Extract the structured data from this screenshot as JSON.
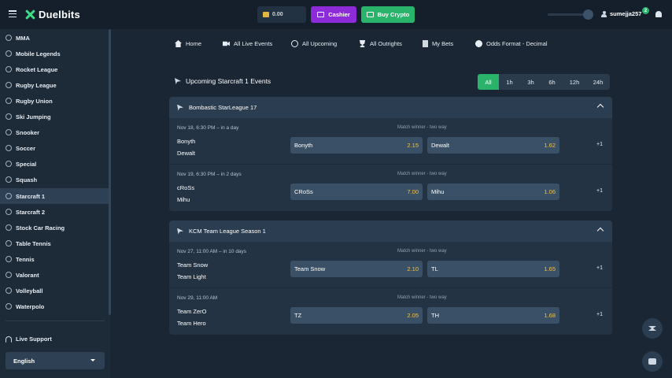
{
  "topbar": {
    "brand": "Duelbits",
    "balance": "0.00",
    "cashier_label": "Cashier",
    "buy_crypto_label": "Buy Crypto",
    "username": "sumejja257",
    "notification_count": "2"
  },
  "sidebar": {
    "items": [
      {
        "label": "MMA",
        "icon": "mma-icon"
      },
      {
        "label": "Mobile Legends",
        "icon": "mobile-legends-icon"
      },
      {
        "label": "Rocket League",
        "icon": "rocket-league-icon"
      },
      {
        "label": "Rugby League",
        "icon": "rugby-icon"
      },
      {
        "label": "Rugby Union",
        "icon": "rugby-icon"
      },
      {
        "label": "Ski Jumping",
        "icon": "ski-icon"
      },
      {
        "label": "Snooker",
        "icon": "snooker-icon"
      },
      {
        "label": "Soccer",
        "icon": "soccer-icon"
      },
      {
        "label": "Special",
        "icon": "special-icon"
      },
      {
        "label": "Squash",
        "icon": "squash-icon"
      },
      {
        "label": "Starcraft 1",
        "icon": "starcraft-icon",
        "active": true
      },
      {
        "label": "Starcraft 2",
        "icon": "starcraft-icon"
      },
      {
        "label": "Stock Car Racing",
        "icon": "car-icon"
      },
      {
        "label": "Table Tennis",
        "icon": "table-tennis-icon"
      },
      {
        "label": "Tennis",
        "icon": "tennis-icon"
      },
      {
        "label": "Valorant",
        "icon": "valorant-icon"
      },
      {
        "label": "Volleyball",
        "icon": "volleyball-icon"
      },
      {
        "label": "Waterpolo",
        "icon": "waterpolo-icon"
      }
    ],
    "live_support": "Live Support",
    "language": "English"
  },
  "nav": {
    "home": "Home",
    "live": "All Live Events",
    "upcoming": "All Upcoming",
    "outrights": "All Outrights",
    "my_bets": "My Bets",
    "odds_format": "Odds Format - Decimal"
  },
  "section_title": "Upcoming Starcraft 1 Events",
  "filters": [
    "All",
    "1h",
    "3h",
    "6h",
    "12h",
    "24h"
  ],
  "leagues": [
    {
      "name": "Bombastic StarLeague 17",
      "matches": [
        {
          "time": "Nov 18, 6:30 PM – in a day",
          "market": "Match winner - two way",
          "team1": "Bonyth",
          "team2": "Dewalt",
          "odd1_label": "Bonyth",
          "odd1": "2.15",
          "odd2_label": "Dewalt",
          "odd2": "1.62",
          "more": "+1"
        },
        {
          "time": "Nov 19, 6:30 PM – in 2 days",
          "market": "Match winner - two way",
          "team1": "cRoSs",
          "team2": "Mihu",
          "odd1_label": "CRoSs",
          "odd1": "7.00",
          "odd2_label": "Mihu",
          "odd2": "1.06",
          "more": "+1"
        }
      ]
    },
    {
      "name": "KCM Team League Season 1",
      "matches": [
        {
          "time": "Nov 27, 11:00 AM – in 10 days",
          "market": "Match winner - two way",
          "team1": "Team Snow",
          "team2": "Team Light",
          "odd1_label": "Team Snow",
          "odd1": "2.10",
          "odd2_label": "TL",
          "odd2": "1.65",
          "more": "+1"
        },
        {
          "time": "Nov 29, 11:00 AM",
          "market": "Match winner - two way",
          "team1": "Team ZerO",
          "team2": "Team Hero",
          "odd1_label": "TZ",
          "odd1": "2.05",
          "odd2_label": "TH",
          "odd2": "1.68",
          "more": "+1"
        }
      ]
    }
  ],
  "colors": {
    "accent": "#2ab36a",
    "cashier": "#8e2bd8",
    "odds": "#f0c04a"
  }
}
